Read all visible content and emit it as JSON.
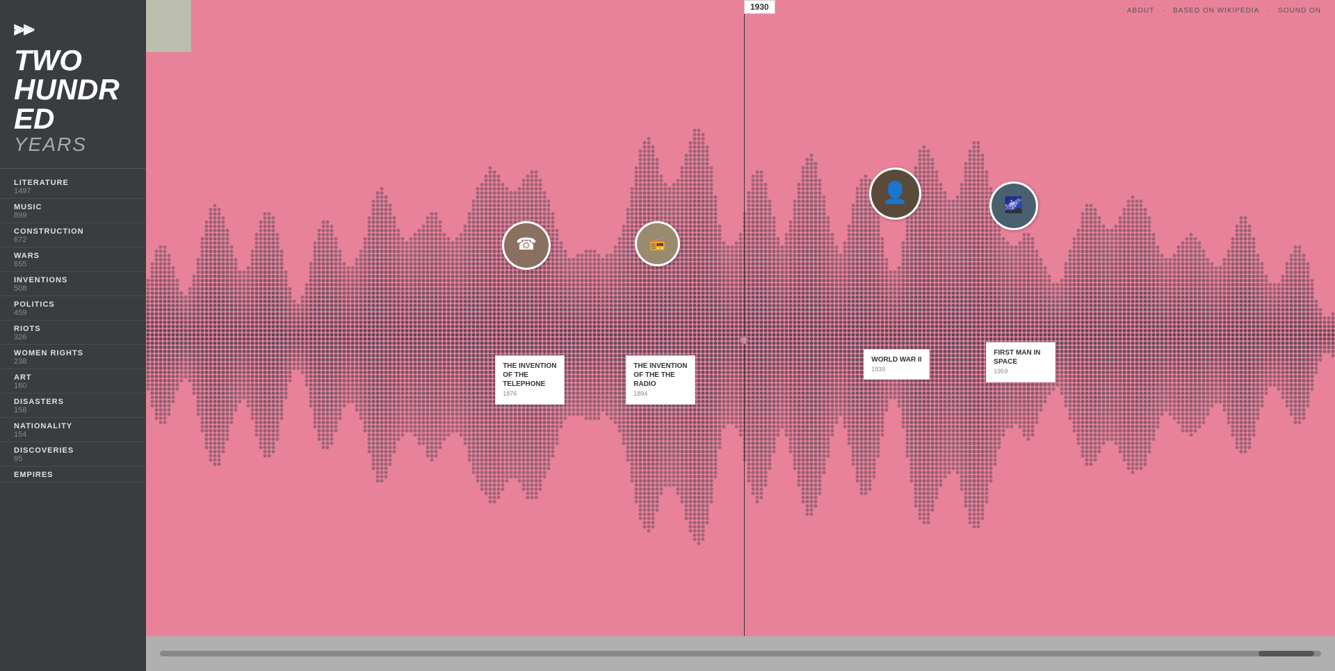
{
  "app": {
    "logo_symbol": "⫶",
    "title_line1": "TWO",
    "title_line2": "HUNDR",
    "title_line3": "ED",
    "title_sub": "YEARS"
  },
  "nav": {
    "about": "ABOUT",
    "based_on": "BASED ON WIKIPEDIA",
    "sound": "SOUND ON",
    "dot": "•"
  },
  "year_indicator": "1930",
  "sidebar_items": [
    {
      "label": "LITERATURE",
      "count": "1497"
    },
    {
      "label": "MUSIC",
      "count": "899"
    },
    {
      "label": "CONSTRUCTION",
      "count": "672"
    },
    {
      "label": "WARS",
      "count": "655"
    },
    {
      "label": "INVENTIONS",
      "count": "508"
    },
    {
      "label": "POLITICS",
      "count": "459"
    },
    {
      "label": "RIOTS",
      "count": "326"
    },
    {
      "label": "WOMEN RIGHTS",
      "count": "238"
    },
    {
      "label": "ART",
      "count": "160"
    },
    {
      "label": "DISASTERS",
      "count": "158"
    },
    {
      "label": "NATIONALITY",
      "count": "154"
    },
    {
      "label": "DISCOVERIES",
      "count": "95"
    },
    {
      "label": "EMPIRES",
      "count": ""
    }
  ],
  "events": [
    {
      "id": "telephone",
      "title": "THE INVENTION OF THE TELEPHONE",
      "year": "1876",
      "circle_color": "#7a6a5a",
      "left": "32%",
      "circle_top": "35%",
      "card_top": "54%"
    },
    {
      "id": "radio",
      "title": "THE INVENTION OF THE THE RADIO",
      "year": "1894",
      "circle_color": "#8a7a6a",
      "left": "43%",
      "circle_top": "35%",
      "card_top": "54%"
    },
    {
      "id": "wwii",
      "title": "WORLD WAR II",
      "year": "1939",
      "circle_color": "#5a4a3a",
      "left": "63%",
      "circle_top": "28%",
      "card_top": "53%"
    },
    {
      "id": "space",
      "title": "FIRST MAN IN SPACE",
      "year": "1959",
      "circle_color": "#4a6a7a",
      "left": "73%",
      "circle_top": "30%",
      "card_top": "53%"
    }
  ]
}
